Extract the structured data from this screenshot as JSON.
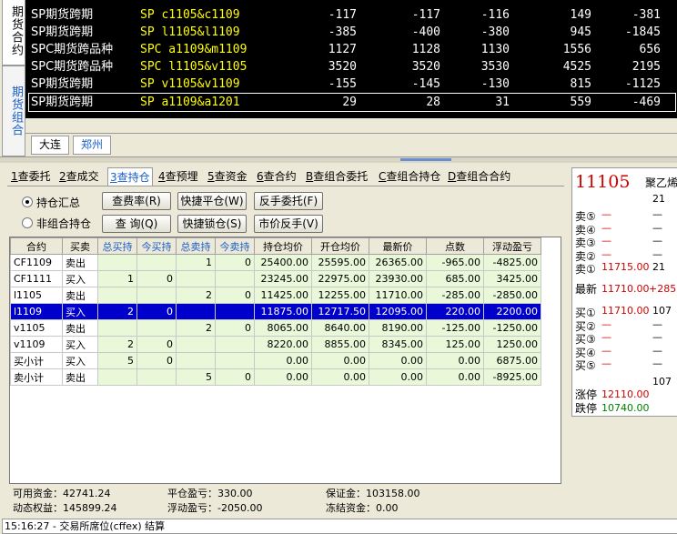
{
  "vtabs": [
    {
      "label": "期货合约",
      "active": false
    },
    {
      "label": "期货组合",
      "active": true
    }
  ],
  "quotes": [
    {
      "name": "SP期货跨期",
      "code": "SP c1105&c1109",
      "v1": "-117",
      "v2": "-117",
      "v3": "-116",
      "v4": "149",
      "v5": "-381"
    },
    {
      "name": "SP期货跨期",
      "code": "SP l1105&l1109",
      "v1": "-385",
      "v2": "-400",
      "v3": "-380",
      "v4": "945",
      "v5": "-1845"
    },
    {
      "name": "SPC期货跨品种",
      "code": "SPC a1109&m1109",
      "v1": "1127",
      "v2": "1128",
      "v3": "1130",
      "v4": "1556",
      "v5": "656"
    },
    {
      "name": "SPC期货跨品种",
      "code": "SPC l1105&v1105",
      "v1": "3520",
      "v2": "3520",
      "v3": "3530",
      "v4": "4525",
      "v5": "2195"
    },
    {
      "name": "SP期货跨期",
      "code": "SP v1105&v1109",
      "v1": "-155",
      "v2": "-145",
      "v3": "-130",
      "v4": "815",
      "v5": "-1125"
    },
    {
      "name": "SP期货跨期",
      "code": "SP a1109&a1201",
      "v1": "29",
      "v2": "28",
      "v3": "31",
      "v4": "559",
      "v5": "-469"
    }
  ],
  "exchange_tabs": [
    {
      "label": "大连",
      "active": false
    },
    {
      "label": "郑州",
      "active": true
    }
  ],
  "subtabs": [
    {
      "key": "1",
      "label": "查委托"
    },
    {
      "key": "2",
      "label": "查成交"
    },
    {
      "key": "3",
      "label": "查持仓"
    },
    {
      "key": "4",
      "label": "查预埋"
    },
    {
      "key": "5",
      "label": "查资金"
    },
    {
      "key": "6",
      "label": "查合约"
    },
    {
      "key": "B",
      "label": "查组合委托"
    },
    {
      "key": "C",
      "label": "查组合持仓"
    },
    {
      "key": "D",
      "label": "查组合合约"
    }
  ],
  "radios": [
    {
      "label": "持仓汇总",
      "checked": true
    },
    {
      "label": "非组合持仓",
      "checked": false
    }
  ],
  "buttons": {
    "fee": "查费率(R)",
    "query": "查 询(Q)",
    "quick_close": "快捷平仓(W)",
    "quick_lock": "快捷锁仓(S)",
    "reverse_order": "反手委托(F)",
    "market_reverse": "市价反手(V)"
  },
  "grid": {
    "headers": [
      "合约",
      "买卖",
      "总买持",
      "今买持",
      "总卖持",
      "今卖持",
      "持仓均价",
      "开仓均价",
      "最新价",
      "点数",
      "浮动盈亏"
    ],
    "rows": [
      [
        "CF1109",
        "卖出",
        "",
        "",
        "1",
        "0",
        "25400.00",
        "25595.00",
        "26365.00",
        "-965.00",
        "-4825.00"
      ],
      [
        "CF1111",
        "买入",
        "1",
        "0",
        "",
        "",
        "23245.00",
        "22975.00",
        "23930.00",
        "685.00",
        "3425.00"
      ],
      [
        "l1105",
        "卖出",
        "",
        "",
        "2",
        "0",
        "11425.00",
        "12255.00",
        "11710.00",
        "-285.00",
        "-2850.00"
      ],
      [
        "l1109",
        "买入",
        "2",
        "0",
        "",
        "",
        "11875.00",
        "12717.50",
        "12095.00",
        "220.00",
        "2200.00"
      ],
      [
        "v1105",
        "卖出",
        "",
        "",
        "2",
        "0",
        "8065.00",
        "8640.00",
        "8190.00",
        "-125.00",
        "-1250.00"
      ],
      [
        "v1109",
        "买入",
        "2",
        "0",
        "",
        "",
        "8220.00",
        "8855.00",
        "8345.00",
        "125.00",
        "1250.00"
      ],
      [
        "买小计",
        "买入",
        "5",
        "0",
        "",
        "",
        "0.00",
        "0.00",
        "0.00",
        "0.00",
        "6875.00"
      ],
      [
        "卖小计",
        "卖出",
        "",
        "",
        "5",
        "0",
        "0.00",
        "0.00",
        "0.00",
        "0.00",
        "-8925.00"
      ]
    ],
    "selected_row": 3
  },
  "summary": {
    "available": "可用资金：42741.24",
    "equity": "动态权益：145899.24",
    "close_pl": "平仓盈亏：330.00",
    "float_pl": "浮动盈亏：-2050.00",
    "margin": "保证金：103158.00",
    "frozen": "冻结资金：0.00"
  },
  "status_text": "15:16:27 - 交易所席位(cffex) 结算",
  "quote_panel": {
    "contract": "11105",
    "name": "聚乙烯",
    "sub": "21",
    "asks": [
      {
        "label": "卖⑤",
        "price": "—",
        "vol": "—"
      },
      {
        "label": "卖④",
        "price": "—",
        "vol": "—"
      },
      {
        "label": "卖③",
        "price": "—",
        "vol": "—"
      },
      {
        "label": "卖②",
        "price": "—",
        "vol": "—"
      },
      {
        "label": "卖①",
        "price": "11715.00",
        "vol": "21"
      }
    ],
    "last_label": "最新",
    "last_price": "11710.00",
    "last_change": "+285.",
    "bids": [
      {
        "label": "买①",
        "price": "11710.00",
        "vol": "107"
      },
      {
        "label": "买②",
        "price": "—",
        "vol": "—"
      },
      {
        "label": "买③",
        "price": "—",
        "vol": "—"
      },
      {
        "label": "买④",
        "price": "—",
        "vol": "—"
      },
      {
        "label": "买⑤",
        "price": "—",
        "vol": "—"
      }
    ],
    "volume": "107",
    "limit_up_label": "涨停",
    "limit_up": "12110.00",
    "limit_down_label": "跌停",
    "limit_down": "10740.00"
  }
}
